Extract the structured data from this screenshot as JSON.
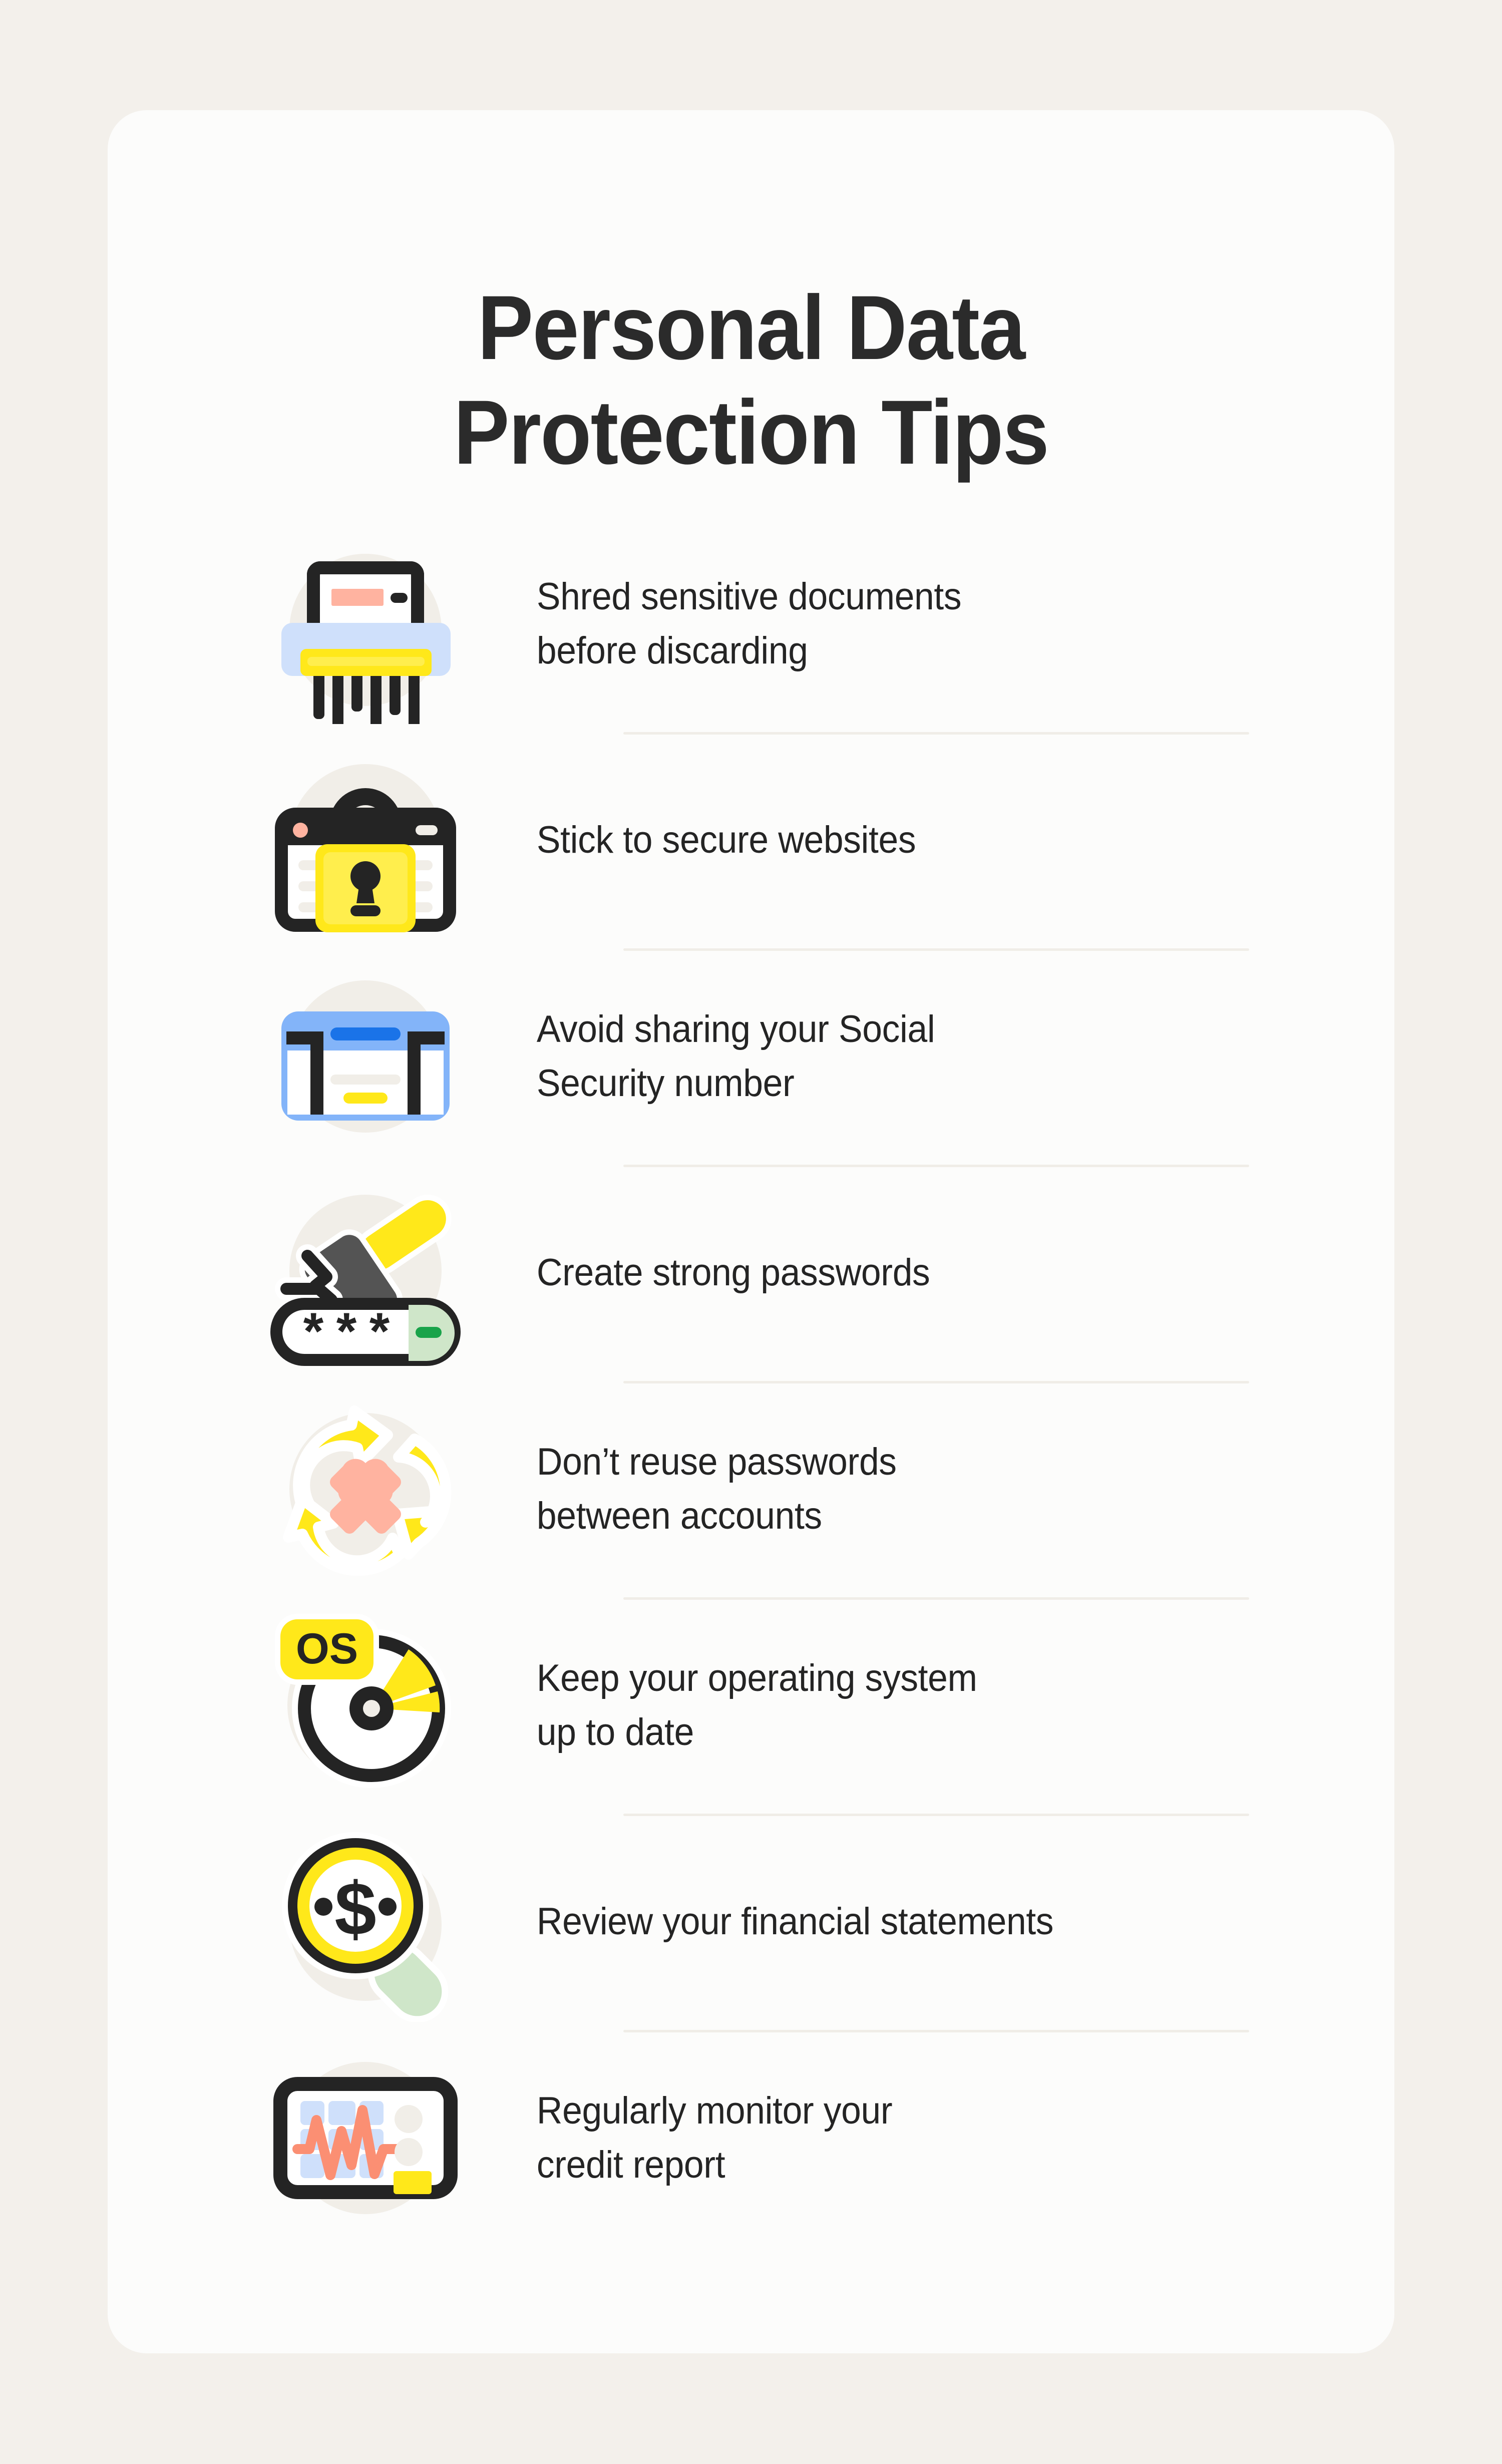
{
  "page": {
    "background_color": "#F3F0EB",
    "card_color": "#FCFCFB"
  },
  "header": {
    "title_line1": "Personal Data",
    "title_line2": "Protection Tips",
    "title_color": "#2B2B2B"
  },
  "palette": {
    "ink": "#242424",
    "yellow": "#FFE81A",
    "yellow_soft": "#FFEE4D",
    "blue": "#83B4F9",
    "blue_light": "#CFE0FB",
    "blue_strong": "#1A73E8",
    "pink": "#FFB3A0",
    "green": "#19A34A",
    "green_light": "#CFE6C9",
    "grey_blob": "#F1EEE8",
    "divider": "#F0EDE7"
  },
  "tips": [
    {
      "icon": "paper-shredder-icon",
      "lines": [
        "Shred sensitive documents",
        "before discarding"
      ]
    },
    {
      "icon": "secure-website-lock-icon",
      "lines": [
        "Stick to secure websites"
      ]
    },
    {
      "icon": "social-security-card-icon",
      "lines": [
        "Avoid sharing your Social",
        "Security number"
      ]
    },
    {
      "icon": "hammer-password-icon",
      "lines": [
        "Create strong passwords"
      ]
    },
    {
      "icon": "recycle-arrows-icon",
      "lines": [
        "Don’t reuse passwords",
        "between accounts"
      ]
    },
    {
      "icon": "operating-system-disc-icon",
      "badge_label": "OS",
      "lines": [
        "Keep your operating system",
        "up to date"
      ]
    },
    {
      "icon": "magnifier-dollar-icon",
      "lines": [
        "Review your financial statements"
      ]
    },
    {
      "icon": "credit-report-monitor-icon",
      "lines": [
        "Regularly monitor your",
        "credit report"
      ]
    }
  ]
}
